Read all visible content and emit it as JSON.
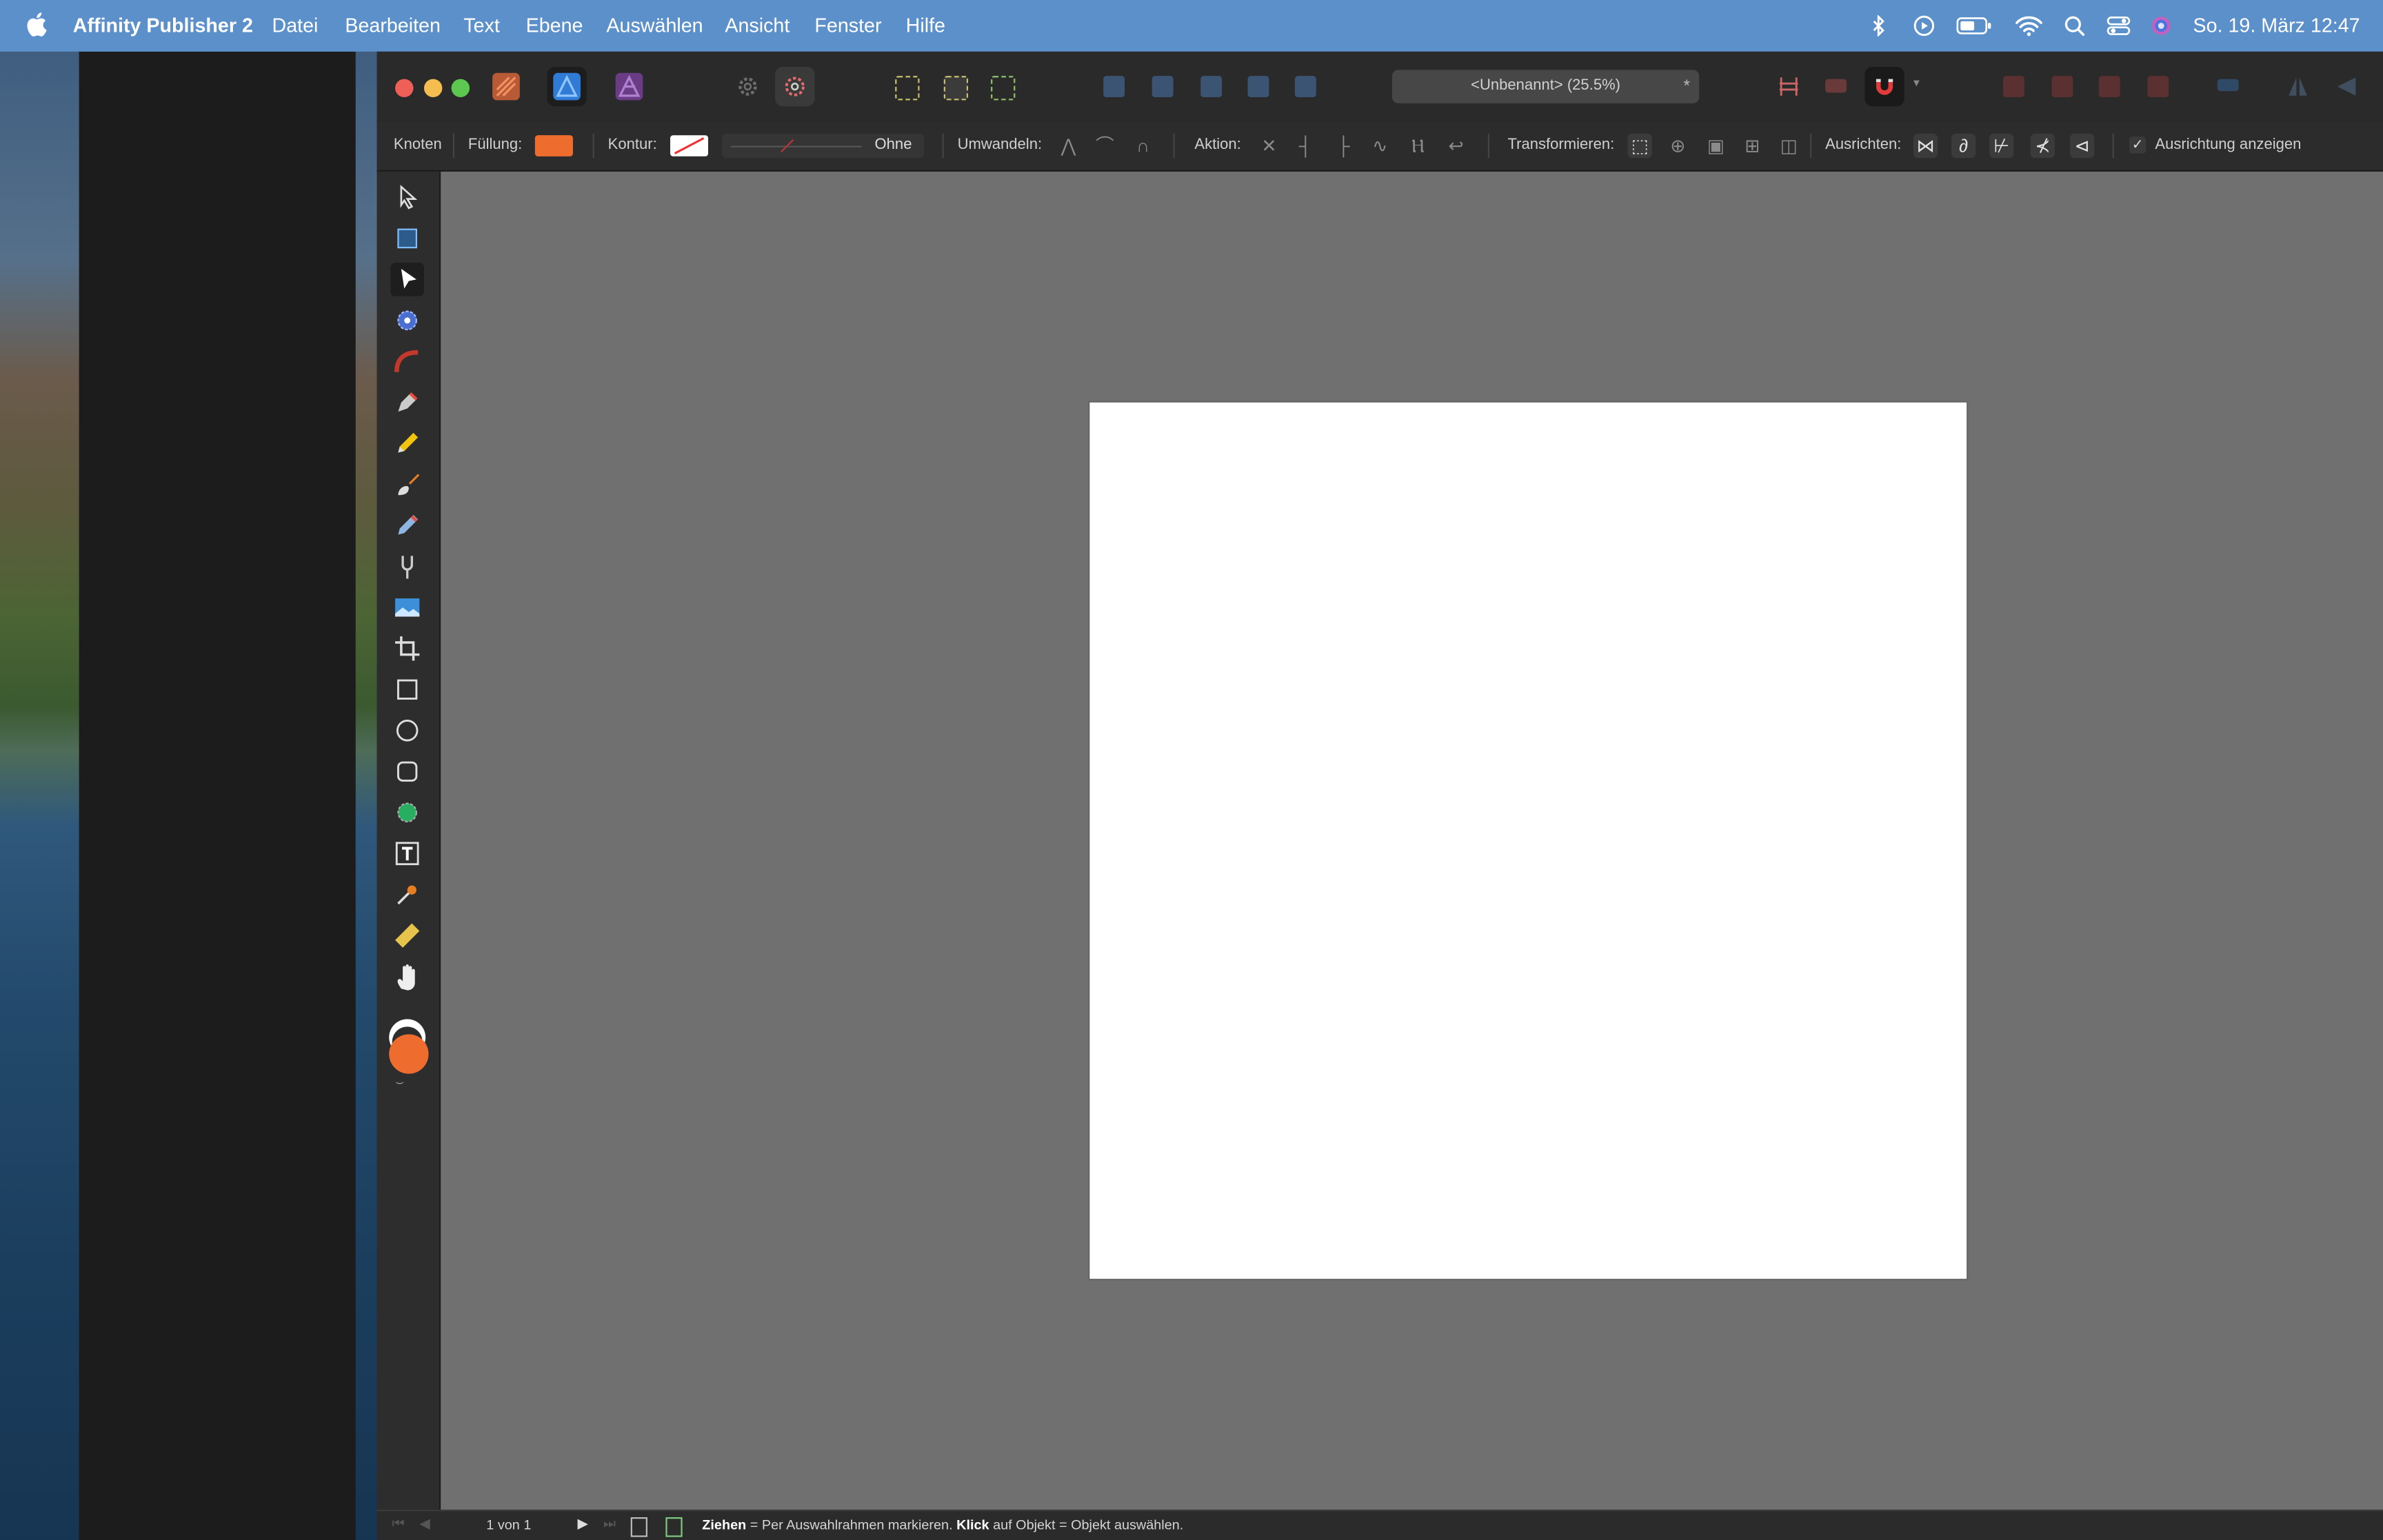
{
  "menubar": {
    "app_name": "Affinity Publisher 2",
    "items": [
      "Datei",
      "Bearbeiten",
      "Text",
      "Ebene",
      "Auswählen",
      "Ansicht",
      "Fenster",
      "Hilfe"
    ],
    "clock": "So. 19. März  12:47"
  },
  "window": {
    "document_title": "<Unbenannt> (25.5%)",
    "modified_marker": "*"
  },
  "context_toolbar": {
    "mode_label": "Knoten",
    "fill_label": "Füllung:",
    "fill_color": "#ef6c2f",
    "stroke_label": "Kontur:",
    "stroke_value": "Ohne",
    "convert_label": "Umwandeln:",
    "action_label": "Aktion:",
    "transform_label": "Transformieren:",
    "snap_label": "Ausrichten:",
    "show_alignment_label": "Ausrichtung anzeigen",
    "show_alignment_checked": true
  },
  "tools": [
    "move-tool",
    "frame-text-tool",
    "node-tool",
    "spiral-tool",
    "contour-tool",
    "pen-tool",
    "pencil-tool",
    "brush-tool",
    "vector-brush-tool",
    "fill-tool",
    "picture-frame-tool",
    "crop-tool",
    "rectangle-tool",
    "ellipse-tool",
    "rounded-rectangle-tool",
    "shape-tool",
    "artistic-text-tool",
    "color-picker-tool",
    "measure-tool",
    "hand-tool"
  ],
  "colors": {
    "accent": "#ef6c2f",
    "menubar": "#5c90ca",
    "canvas": "#707070",
    "page": "#ffffff"
  },
  "statusbar": {
    "page_indicator": "1 von 1",
    "hint_drag": "Ziehen",
    "hint_drag_text": " = Per Auswahlrahmen markieren. ",
    "hint_click": "Klick",
    "hint_click_text": " auf Objekt = Objekt auswählen."
  }
}
